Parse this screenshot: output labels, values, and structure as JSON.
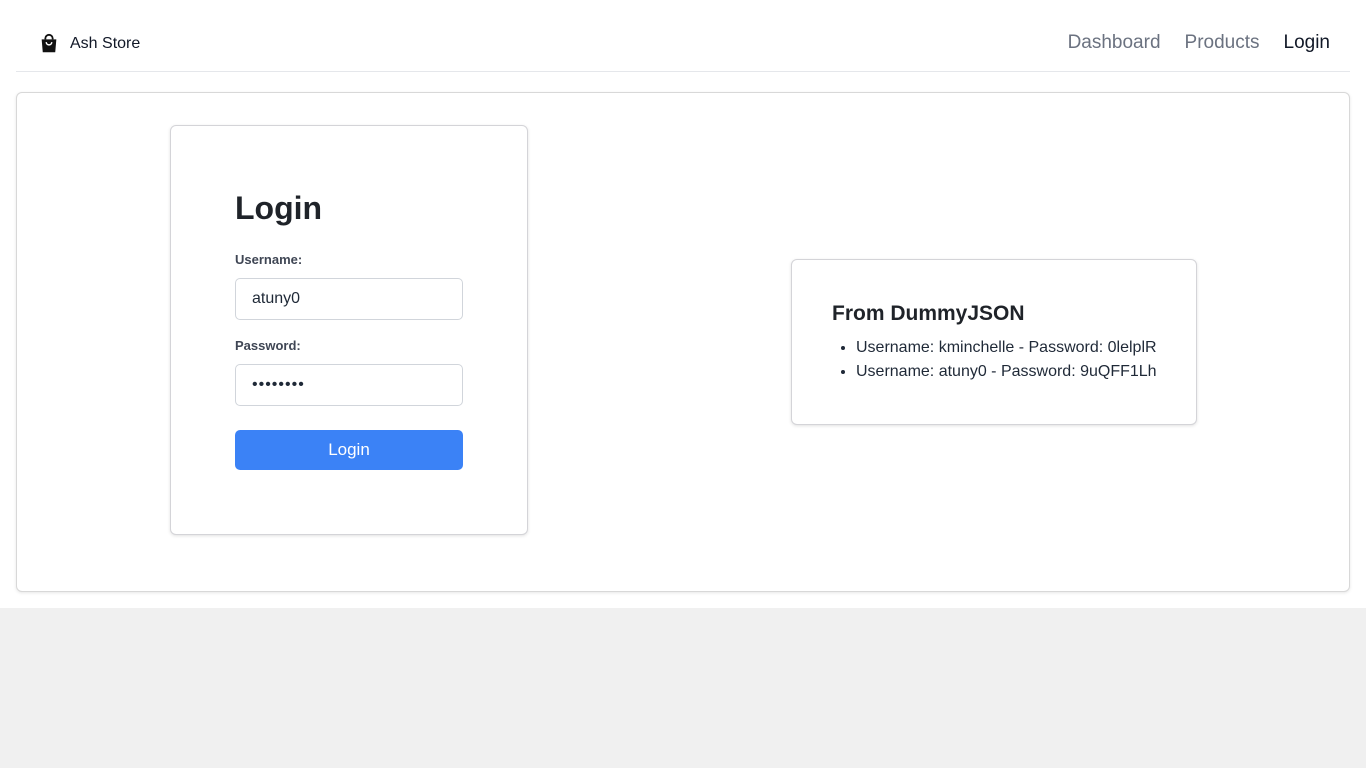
{
  "header": {
    "brand": {
      "icon": "shopping-bag-icon",
      "name": "Ash Store"
    },
    "nav": [
      {
        "label": "Dashboard",
        "active": false
      },
      {
        "label": "Products",
        "active": false
      },
      {
        "label": "Login",
        "active": true
      }
    ]
  },
  "login_form": {
    "title": "Login",
    "username_label": "Username:",
    "username_value": "atuny0",
    "password_label": "Password:",
    "password_value": "9uQFF1Lh",
    "submit_label": "Login"
  },
  "info": {
    "title": "From DummyJSON",
    "items": [
      "Username: kminchelle - Password: 0lelplR",
      "Username: atuny0 - Password: 9uQFF1Lh"
    ]
  },
  "colors": {
    "accent": "#3b82f6",
    "page_background": "#f0f0f0",
    "nav_inactive": "#6b7280",
    "nav_active": "#111827"
  }
}
